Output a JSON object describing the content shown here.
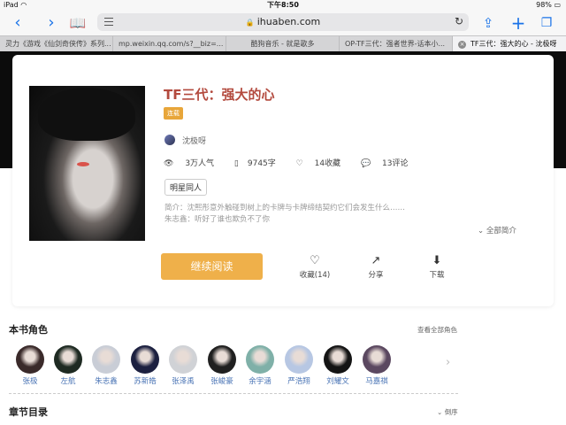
{
  "status": {
    "device": "iPad",
    "wifi": "◠",
    "time": "下午8:50",
    "battery": "98%"
  },
  "browser": {
    "url": "ihuaben.com",
    "tabs": [
      {
        "label": "灵力《游戏《仙剑奇侠传》系列..."
      },
      {
        "label": "mp.weixin.qq.com/s?__biz=..."
      },
      {
        "label": "酷狗音乐 - 就是歌多"
      },
      {
        "label": "OP-TF三代：强者世界-话本小..."
      },
      {
        "label": "TF三代：强大的心 - 沈极呀"
      }
    ]
  },
  "book": {
    "title": "TF三代：强大的心",
    "status_badge": "连载",
    "author": "沈极呀",
    "stats": {
      "popularity": "3万人气",
      "words": "9745字",
      "favorites": "14收藏",
      "comments": "13评论"
    },
    "genre": "明星同人",
    "summary_line1": "简介：沈熙彤意外触碰到树上的卡牌与卡牌缔结契约它们会发生什么……",
    "summary_line2": "朱志鑫：听好了谁也欺负不了你",
    "full_summary": "全部简介"
  },
  "actions": {
    "read": "继续阅读",
    "favorite": "收藏(14)",
    "share": "分享",
    "download": "下载"
  },
  "characters": {
    "section_title": "本书角色",
    "view_all": "查看全部角色",
    "items": [
      {
        "name": "张极",
        "color": "#3a2a2a"
      },
      {
        "name": "左航",
        "color": "#1e2a22"
      },
      {
        "name": "朱志鑫",
        "color": "#c9cdd6"
      },
      {
        "name": "苏新皓",
        "color": "#1c2040"
      },
      {
        "name": "张泽禹",
        "color": "#d0d2d6"
      },
      {
        "name": "张峻豪",
        "color": "#202020"
      },
      {
        "name": "余宇涵",
        "color": "#7fb0a8"
      },
      {
        "name": "严浩翔",
        "color": "#b7c7e3"
      },
      {
        "name": "刘耀文",
        "color": "#141414"
      },
      {
        "name": "马嘉祺",
        "color": "#5b4860"
      }
    ]
  },
  "chapters": {
    "section_title": "章节目录",
    "sort": "倒序"
  }
}
